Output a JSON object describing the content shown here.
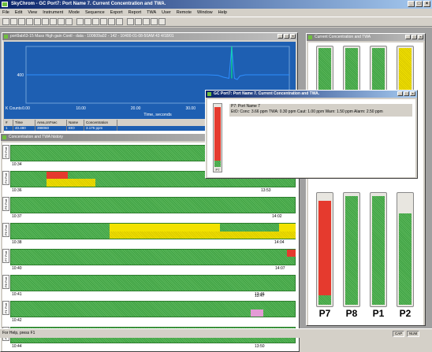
{
  "app": {
    "title": "SkyChrom - GC Port7: Port Name 7. Current Concentration and TWA."
  },
  "menu": [
    "File",
    "Edit",
    "View",
    "Instrument",
    "Mode",
    "Sequence",
    "Export",
    "Report",
    "TWA",
    "User",
    "Remote",
    "Window",
    "Help"
  ],
  "chart_window": {
    "title": "port9ab63-15 Mass High gain Contl - data - 100609a02 - 142 - 10400-01-08-50AM 43 4/18/01"
  },
  "chart_data": {
    "type": "line",
    "xlabel": "Time, seconds",
    "ylabel": "K Counts",
    "yticks": [
      "400"
    ],
    "xticks": [
      "0.00",
      "10.00",
      "20.00",
      "30.00",
      "40"
    ],
    "x": [
      0,
      5,
      10,
      15,
      20,
      25,
      30,
      33,
      35,
      36,
      37,
      37.5,
      38,
      38.5,
      39,
      40,
      42,
      45,
      48
    ],
    "values": [
      400,
      400,
      400,
      400,
      400,
      400,
      400,
      400,
      398,
      390,
      385,
      520,
      385,
      380,
      395,
      400,
      400,
      400,
      400
    ],
    "xlim": [
      0,
      48
    ],
    "ylim": [
      280,
      520
    ]
  },
  "table": {
    "headers": [
      "#",
      "Time",
      "Area,cnt*sec",
      "Name",
      "Concentration"
    ],
    "rows": [
      [
        "1",
        "40.480",
        "398060",
        "EtO",
        "3.175 ppm"
      ]
    ]
  },
  "history_window": {
    "title": "Concentration and TWA history"
  },
  "history_rows": [
    {
      "port": "P3 Port",
      "start": "10:34",
      "end": ""
    },
    {
      "port": "P4 Port",
      "start": "10:36",
      "end": "13:53"
    },
    {
      "port": "P5 Port",
      "start": "10:37",
      "end": "14:02"
    },
    {
      "port": "P6 Port",
      "start": "10:38",
      "end": "14:04"
    },
    {
      "port": "P7 Port",
      "start": "10:40",
      "end": "14:07"
    },
    {
      "port": "P8 Port",
      "start": "10:41",
      "end": "13:46"
    },
    {
      "port": "P1 Port",
      "start": "10:42",
      "end": "13:47"
    },
    {
      "port": "P2 Port",
      "start": "10:44",
      "end": "13:50"
    }
  ],
  "bars_window": {
    "title": "Current Concentration and TWA"
  },
  "tubes_bottom": [
    {
      "label": "P7"
    },
    {
      "label": "P8"
    },
    {
      "label": "P1"
    },
    {
      "label": "P2"
    }
  ],
  "popup": {
    "title": "GC Port7: Port Name 7. Current Concentration and TWA.",
    "line1": "P7: Port Name 7",
    "line2": "EtO: Conc: 3.66 ppm   TWA: 0.30 ppm   Caut: 1.00 ppm   Warn: 1.50 ppm   Alarm: 2.50 ppm",
    "tube_label": "P7"
  },
  "status": {
    "text": "For Help, press F1",
    "cap": "CAP",
    "num": "NUM"
  }
}
